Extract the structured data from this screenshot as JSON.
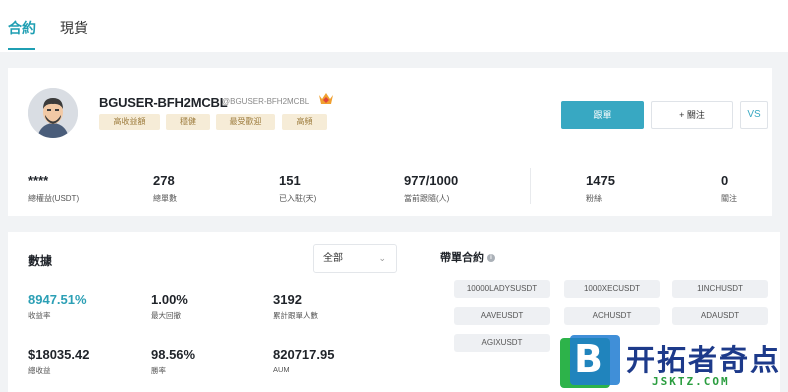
{
  "tabs": [
    {
      "label": "合約",
      "active": true
    },
    {
      "label": "現貨",
      "active": false
    }
  ],
  "profile": {
    "username": "BGUSER-BFH2MCBL",
    "handle": "@BGUSER-BFH2MCBL",
    "tags": [
      "高收益額",
      "穩健",
      "最受歡迎",
      "高頻"
    ],
    "follow_label": "跟單",
    "watch_label": "+ 關注",
    "vs_label": "VS"
  },
  "stats": [
    {
      "value": "****",
      "label": "總權益(USDT)"
    },
    {
      "value": "278",
      "label": "總單數"
    },
    {
      "value": "151",
      "label": "已入駐(天)"
    },
    {
      "value": "977/1000",
      "label": "當前跟隨(人)"
    },
    {
      "value": "1475",
      "label": "粉絲"
    },
    {
      "value": "0",
      "label": "關注"
    }
  ],
  "data_section": {
    "title": "數據",
    "filter_selected": "全部",
    "metrics": [
      {
        "value": "8947.51%",
        "label": "收益率",
        "accent": true
      },
      {
        "value": "1.00%",
        "label": "最大回撤",
        "accent": false
      },
      {
        "value": "3192",
        "label": "累計跟單人數",
        "accent": false
      },
      {
        "value": "$18035.42",
        "label": "總收益",
        "accent": false
      },
      {
        "value": "98.56%",
        "label": "勝率",
        "accent": false
      },
      {
        "value": "820717.95",
        "label": "AUM",
        "accent": false
      }
    ]
  },
  "contracts": {
    "title": "帶單合約",
    "info_icon": "i",
    "items": [
      "10000LADYSUSDT",
      "1000XECUSDT",
      "1INCHUSDT",
      "AAVEUSDT",
      "ACHUSDT",
      "ADAUSDT",
      "AGIXUSDT"
    ]
  },
  "watermark": {
    "letter": "B",
    "title": "开拓者奇点",
    "subtitle": "JSKTZ.COM"
  },
  "colors": {
    "accent": "#38a8c2",
    "tag_bg": "#f6ecd7",
    "tag_text": "#9c7b3c"
  }
}
